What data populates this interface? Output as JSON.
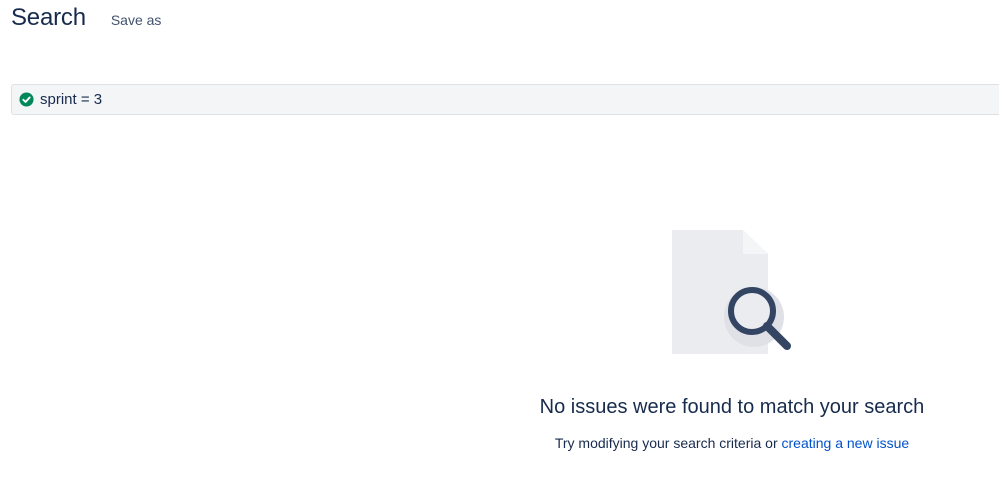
{
  "header": {
    "title": "Search",
    "save_as_label": "Save as"
  },
  "jql": {
    "query": "sprint = 3",
    "status_icon": "check-circle-icon",
    "status_color": "#00875a"
  },
  "empty_state": {
    "illustration_icon": "document-magnifier-icon",
    "title": "No issues were found to match your search",
    "message_prefix": "Try modifying your search criteria or ",
    "link_text": "creating a new issue"
  },
  "colors": {
    "link": "#0052cc",
    "text": "#172b4d",
    "bar_background": "#f4f5f7"
  }
}
